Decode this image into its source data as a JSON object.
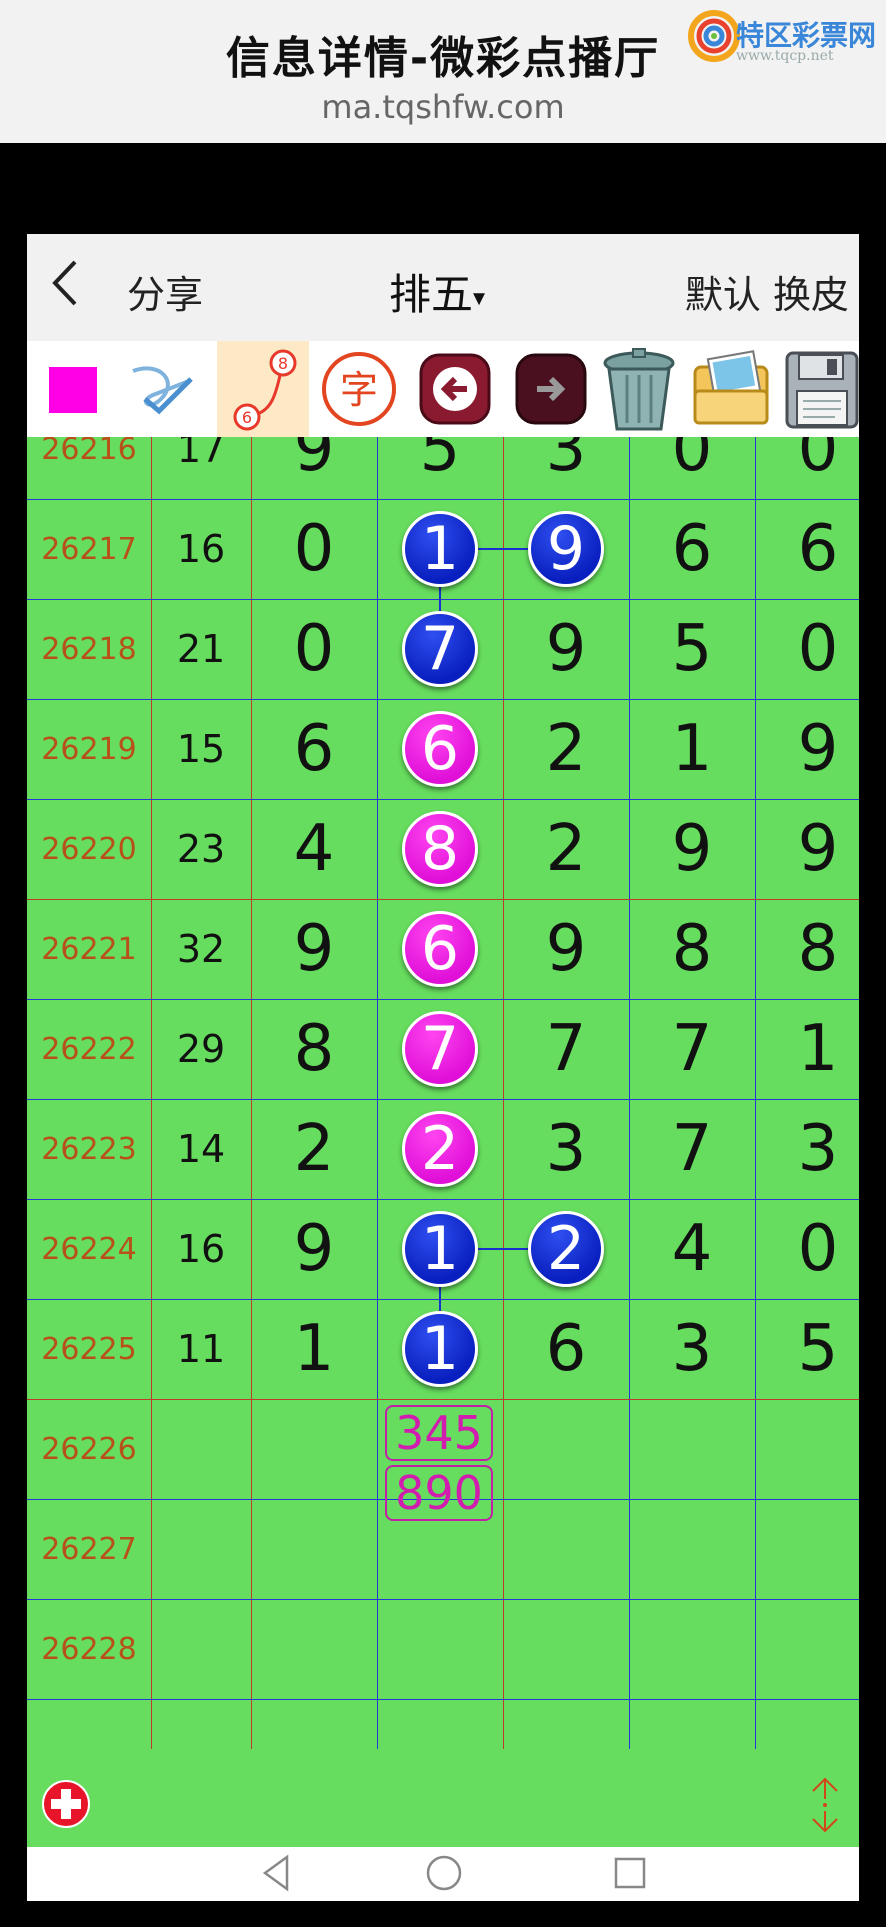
{
  "browser": {
    "title": "信息详情-微彩点播厅",
    "url": "ma.tqshfw.com",
    "logo_name": "特区彩票网",
    "logo_site": "www.tqcp.net"
  },
  "header": {
    "back_icon": "chevron-left-icon",
    "share_label": "分享",
    "title": "排五",
    "title_caret": "▾",
    "default_label": "默认",
    "skin_label": "换皮"
  },
  "toolbar": {
    "items": [
      {
        "name": "color-swatch-icon",
        "color": "#ff00e6"
      },
      {
        "name": "pen-line-icon"
      },
      {
        "name": "connect-numbers-icon",
        "top_num": "8",
        "bottom_num": "6"
      },
      {
        "name": "text-char-icon",
        "char": "字"
      },
      {
        "name": "undo-arrow-icon"
      },
      {
        "name": "redo-arrow-icon"
      },
      {
        "name": "trash-can-icon"
      },
      {
        "name": "photo-folder-icon"
      },
      {
        "name": "floppy-save-icon"
      }
    ]
  },
  "table": {
    "rows": [
      {
        "issue": "26216",
        "sum": "17",
        "digits": [
          "9",
          "5",
          "3",
          "0",
          "0"
        ]
      },
      {
        "issue": "26217",
        "sum": "16",
        "digits": [
          "0",
          "1",
          "9",
          "6",
          "6"
        ]
      },
      {
        "issue": "26218",
        "sum": "21",
        "digits": [
          "0",
          "7",
          "9",
          "5",
          "0"
        ]
      },
      {
        "issue": "26219",
        "sum": "15",
        "digits": [
          "6",
          "6",
          "2",
          "1",
          "9"
        ]
      },
      {
        "issue": "26220",
        "sum": "23",
        "digits": [
          "4",
          "8",
          "2",
          "9",
          "9"
        ]
      },
      {
        "issue": "26221",
        "sum": "32",
        "digits": [
          "9",
          "6",
          "9",
          "8",
          "8"
        ]
      },
      {
        "issue": "26222",
        "sum": "29",
        "digits": [
          "8",
          "7",
          "7",
          "7",
          "1"
        ]
      },
      {
        "issue": "26223",
        "sum": "14",
        "digits": [
          "2",
          "2",
          "3",
          "7",
          "3"
        ]
      },
      {
        "issue": "26224",
        "sum": "16",
        "digits": [
          "9",
          "1",
          "2",
          "4",
          "0"
        ]
      },
      {
        "issue": "26225",
        "sum": "11",
        "digits": [
          "1",
          "1",
          "6",
          "3",
          "5"
        ]
      },
      {
        "issue": "26226",
        "sum": "",
        "digits": [
          "",
          "",
          "",
          "",
          ""
        ]
      },
      {
        "issue": "26227",
        "sum": "",
        "digits": [
          "",
          "",
          "",
          "",
          ""
        ]
      },
      {
        "issue": "26228",
        "sum": "",
        "digits": [
          "",
          "",
          "",
          "",
          ""
        ]
      }
    ],
    "highlights": [
      {
        "row": 1,
        "col": 1,
        "color": "blue"
      },
      {
        "row": 1,
        "col": 2,
        "color": "blue"
      },
      {
        "row": 2,
        "col": 1,
        "color": "blue"
      },
      {
        "row": 3,
        "col": 1,
        "color": "pink"
      },
      {
        "row": 4,
        "col": 1,
        "color": "pink"
      },
      {
        "row": 5,
        "col": 1,
        "color": "pink"
      },
      {
        "row": 6,
        "col": 1,
        "color": "pink"
      },
      {
        "row": 7,
        "col": 1,
        "color": "pink"
      },
      {
        "row": 8,
        "col": 1,
        "color": "blue"
      },
      {
        "row": 8,
        "col": 2,
        "color": "blue"
      },
      {
        "row": 9,
        "col": 1,
        "color": "blue"
      }
    ],
    "predictions": [
      "345",
      "890"
    ],
    "colors": {
      "background": "#66dd5e",
      "issue_text": "#b8501a",
      "blue_ball": "#0a1fbf",
      "pink_ball": "#e010d8",
      "prediction": "#d21cb0"
    }
  },
  "bottom": {
    "add_icon": "plus-circle-icon",
    "scroll_icon": "up-down-arrows-icon"
  },
  "navbar": {
    "back_icon": "nav-back-triangle-icon",
    "home_icon": "nav-home-circle-icon",
    "recent_icon": "nav-recent-square-icon"
  }
}
